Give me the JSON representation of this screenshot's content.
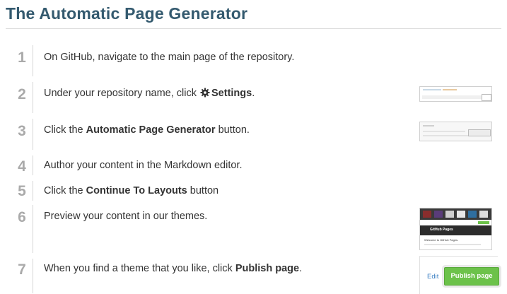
{
  "title": "The Automatic Page Generator",
  "steps": [
    {
      "number": "1",
      "text": "On GitHub, navigate to the main page of the repository."
    },
    {
      "number": "2",
      "pre": "Under your repository name, click ",
      "icon": "gear-icon",
      "bold": "Settings",
      "post": "."
    },
    {
      "number": "3",
      "pre": "Click the ",
      "bold": "Automatic Page Generator",
      "post": " button."
    },
    {
      "number": "4",
      "text": "Author your content in the Markdown editor."
    },
    {
      "number": "5",
      "pre": "Click the ",
      "bold": "Continue To Layouts",
      "post": " button"
    },
    {
      "number": "6",
      "text": "Preview your content in our themes."
    },
    {
      "number": "7",
      "pre": "When you find a theme that you like, click ",
      "bold": "Publish page",
      "post": "."
    }
  ],
  "thumbnails": {
    "theme_preview_title": "GitHub Pages",
    "theme_preview_welcome": "Welcome to GitHub Pages.",
    "publish_button": "Publish page",
    "edit_link": "Edit"
  },
  "colors": {
    "title": "#345a6f",
    "step_number": "#aaaaaa",
    "publish_green": "#6cc24a",
    "link_blue": "#4183c4"
  }
}
